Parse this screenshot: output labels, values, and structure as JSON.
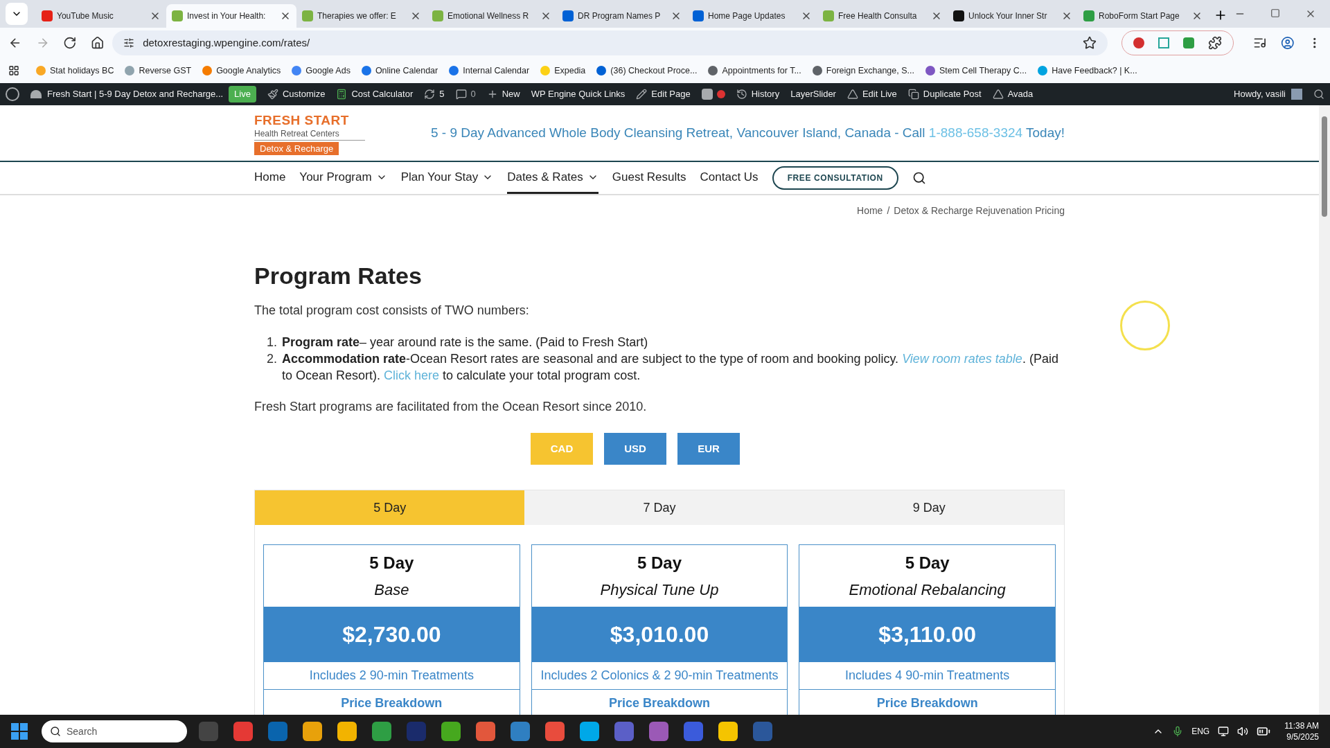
{
  "browser_tabs": [
    {
      "title": "YouTube Music",
      "selected": false
    },
    {
      "title": "Invest in Your Health:",
      "selected": true
    },
    {
      "title": "Therapies we offer: E",
      "selected": false
    },
    {
      "title": "Emotional Wellness R",
      "selected": false
    },
    {
      "title": "DR Program Names P",
      "selected": false
    },
    {
      "title": "Home Page Updates",
      "selected": false
    },
    {
      "title": "Free Health Consulta",
      "selected": false
    },
    {
      "title": "Unlock Your Inner Str",
      "selected": false
    },
    {
      "title": "RoboForm Start Page",
      "selected": false
    }
  ],
  "address_bar": {
    "url": "detoxrestaging.wpengine.com/rates/"
  },
  "bookmarks": [
    {
      "label": "Stat holidays BC",
      "color": "#f9a825"
    },
    {
      "label": "Reverse GST",
      "color": "#90a4ae"
    },
    {
      "label": "Google Analytics",
      "color": "#f57c00"
    },
    {
      "label": "Google Ads",
      "color": "#4285f4"
    },
    {
      "label": "Online Calendar",
      "color": "#1a73e8"
    },
    {
      "label": "Internal Calendar",
      "color": "#1a73e8"
    },
    {
      "label": "Expedia",
      "color": "#fcd116"
    },
    {
      "label": "(36) Checkout Proce...",
      "color": "#0061d5"
    },
    {
      "label": "Appointments for T...",
      "color": "#5f6368"
    },
    {
      "label": "Foreign Exchange, S...",
      "color": "#5f6368"
    },
    {
      "label": "Stem Cell Therapy C...",
      "color": "#7e57c2"
    },
    {
      "label": "Have Feedback? | K...",
      "color": "#00a3e0"
    }
  ],
  "admin_bar": {
    "site": "Fresh Start | 5-9 Day Detox and Recharge...",
    "badge": "Live",
    "items_left": [
      {
        "label": "Customize",
        "kind": "brush"
      },
      {
        "label": "Cost Calculator",
        "kind": "calc"
      },
      {
        "label": "5",
        "kind": "updates"
      },
      {
        "label": "0",
        "kind": "comments"
      },
      {
        "label": "New",
        "kind": "new"
      },
      {
        "label": "WP Engine Quick Links",
        "kind": "plain"
      },
      {
        "label": "Edit Page",
        "kind": "edit"
      },
      {
        "kind": "seo"
      },
      {
        "label": "History",
        "kind": "history"
      },
      {
        "label": "LayerSlider",
        "kind": "plain"
      },
      {
        "label": "Edit Live",
        "kind": "avada"
      },
      {
        "label": "Duplicate Post",
        "kind": "copy"
      },
      {
        "label": "Avada",
        "kind": "avada"
      }
    ],
    "greeting": "Howdy, vasili"
  },
  "header": {
    "logo": {
      "name": "FRESH START",
      "tagline": "Health Retreat Centers",
      "ribbon": "Detox & Recharge"
    },
    "headline": "5 - 9 Day Advanced Whole Body Cleansing Retreat, Vancouver Island, Canada - Call",
    "phone": "1-888-658-3324",
    "headline_end": "Today!"
  },
  "nav": {
    "items": [
      {
        "label": "Home",
        "dropdown": false,
        "selected": false
      },
      {
        "label": "Your Program",
        "dropdown": true,
        "selected": false
      },
      {
        "label": "Plan Your Stay",
        "dropdown": true,
        "selected": false
      },
      {
        "label": "Dates & Rates",
        "dropdown": true,
        "selected": true
      },
      {
        "label": "Guest Results",
        "dropdown": false,
        "selected": false
      },
      {
        "label": "Contact Us",
        "dropdown": false,
        "selected": false
      }
    ],
    "cta": "FREE CONSULTATION"
  },
  "breadcrumb": {
    "home": "Home",
    "separator": "/",
    "current": "Detox & Recharge Rejuvenation Pricing"
  },
  "content": {
    "title": "Program Rates",
    "intro": "The total program cost consists of TWO numbers:",
    "list": [
      {
        "number": "1.",
        "parts": [
          {
            "text": "**Program rate**– year around rate is the same. (Paid to Fresh Start)"
          }
        ]
      },
      {
        "number": "2.",
        "parts": [
          {
            "text": "**Accommodation rate**-Ocean Resort rates are seasonal and are subject to the type of room and booking policy. "
          },
          {
            "link": "View room rates table",
            "italic": true
          },
          {
            "text": ". (Paid to Ocean Resort). "
          },
          {
            "link": "Click here",
            "italic": false
          },
          {
            "text": " to calculate your total program cost."
          }
        ]
      }
    ],
    "note": "Fresh Start programs are facilitated from the Ocean Resort since 2010."
  },
  "currencies": [
    {
      "label": "CAD",
      "selected": true
    },
    {
      "label": "USD",
      "selected": false
    },
    {
      "label": "EUR",
      "selected": false
    }
  ],
  "durations": [
    {
      "label": "5 Day",
      "selected": true
    },
    {
      "label": "7 Day",
      "selected": false
    },
    {
      "label": "9 Day",
      "selected": false
    }
  ],
  "cards": [
    {
      "title": "5 Day",
      "subtitle": "Base",
      "price": "$2,730.00",
      "includes": "Includes 2 90-min Treatments",
      "breakdown": "Price Breakdown"
    },
    {
      "title": "5 Day",
      "subtitle": "Physical Tune Up",
      "price": "$3,010.00",
      "includes": "Includes 2 Colonics & 2 90-min Treatments",
      "breakdown": "Price Breakdown"
    },
    {
      "title": "5 Day",
      "subtitle": "Emotional Rebalancing",
      "price": "$3,110.00",
      "includes": "Includes 4 90-min Treatments",
      "breakdown": "Price Breakdown"
    }
  ],
  "taskbar": {
    "search_placeholder": "Search",
    "language": "ENG",
    "time": "11:38 AM",
    "date": "9/5/2025"
  }
}
